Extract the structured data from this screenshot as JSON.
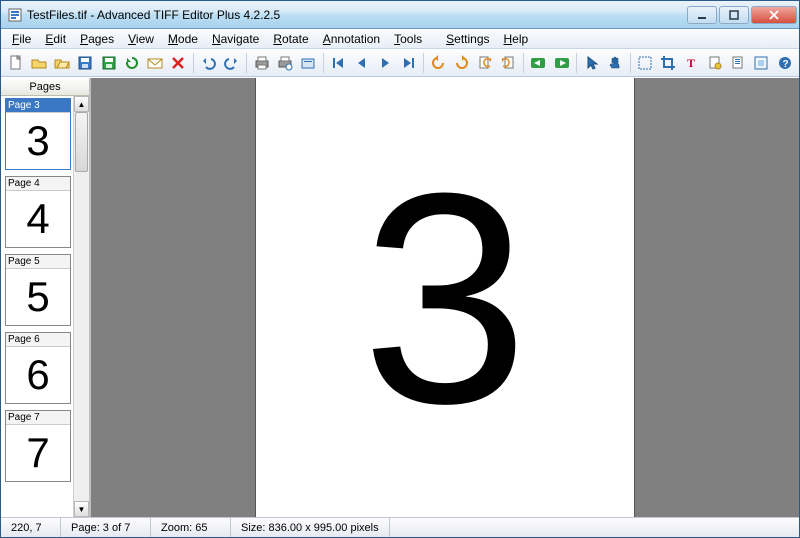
{
  "window": {
    "title": "TestFiles.tif - Advanced TIFF Editor Plus 4.2.2.5"
  },
  "menu": {
    "items": [
      {
        "label": "File",
        "u": "F"
      },
      {
        "label": "Edit",
        "u": "E"
      },
      {
        "label": "Pages",
        "u": "P"
      },
      {
        "label": "View",
        "u": "V"
      },
      {
        "label": "Mode",
        "u": "M"
      },
      {
        "label": "Navigate",
        "u": "N"
      },
      {
        "label": "Rotate",
        "u": "R"
      },
      {
        "label": "Annotation",
        "u": "A"
      },
      {
        "label": "Tools",
        "u": "T"
      },
      {
        "label": "Settings",
        "u": "S"
      },
      {
        "label": "Help",
        "u": "H"
      }
    ]
  },
  "pages_panel": {
    "header": "Pages",
    "thumbs": [
      {
        "label": "Page 3",
        "content": "3",
        "selected": true
      },
      {
        "label": "Page 4",
        "content": "4",
        "selected": false
      },
      {
        "label": "Page 5",
        "content": "5",
        "selected": false
      },
      {
        "label": "Page 6",
        "content": "6",
        "selected": false
      },
      {
        "label": "Page 7",
        "content": "7",
        "selected": false
      }
    ]
  },
  "canvas": {
    "page_content": "3"
  },
  "status": {
    "coords": "220, 7",
    "page": "Page: 3 of 7",
    "zoom": "Zoom: 65",
    "size": "Size: 836.00 x 995.00 pixels"
  },
  "toolbar": {
    "icons": [
      "new",
      "open",
      "open-folder",
      "save",
      "save-as",
      "revert",
      "mail",
      "delete",
      "sep",
      "undo",
      "redo",
      "sep",
      "print",
      "print-preview",
      "scan",
      "sep",
      "first",
      "prev",
      "next",
      "last",
      "sep",
      "rotate-left",
      "rotate-right",
      "page-left",
      "page-right",
      "sep",
      "go-back",
      "go-forward",
      "sep",
      "pointer",
      "hand",
      "sep",
      "select-area",
      "crop",
      "text-tool",
      "stamp",
      "properties",
      "fit",
      "help"
    ]
  }
}
